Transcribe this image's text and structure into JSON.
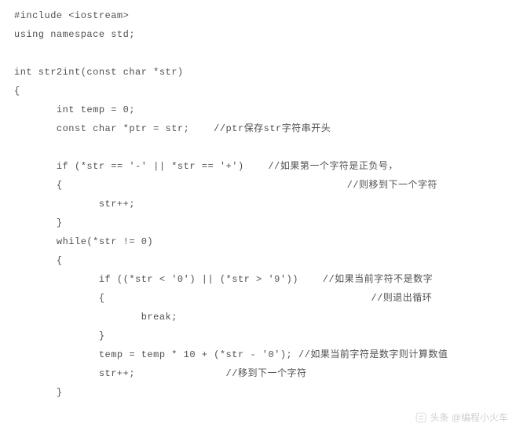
{
  "lines": [
    "#include <iostream>",
    "using namespace std;",
    "",
    "int str2int(const char *str)",
    "{",
    "       int temp = 0;",
    "       const char *ptr = str;    //ptr保存str字符串开头",
    "",
    "       if (*str == '-' || *str == '+')    //如果第一个字符是正负号，",
    "       {                                               //则移到下一个字符",
    "              str++;",
    "       }",
    "       while(*str != 0)",
    "       {",
    "              if ((*str < '0') || (*str > '9'))    //如果当前字符不是数字",
    "              {                                            //则退出循环",
    "                     break;",
    "              }",
    "              temp = temp * 10 + (*str - '0'); //如果当前字符是数字则计算数值",
    "              str++;               //移到下一个字符",
    "       }"
  ],
  "watermark": {
    "text": "头条 @编程小火车"
  }
}
